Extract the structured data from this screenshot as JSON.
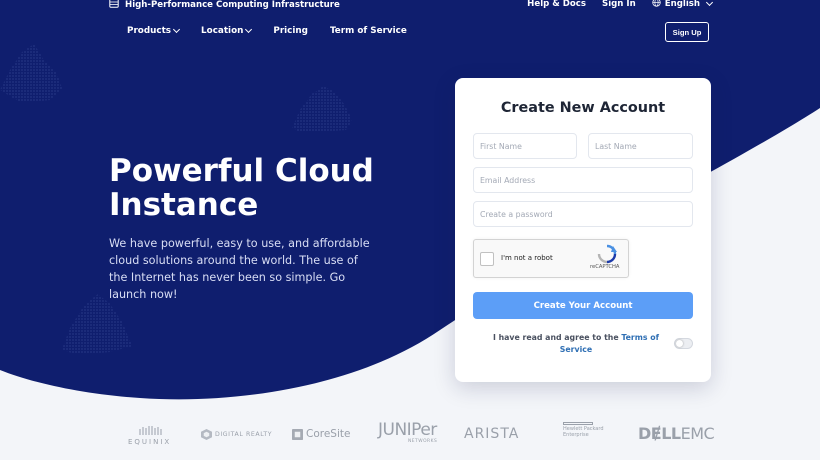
{
  "topbar": {
    "brand": "High-Performance Computing Infrastructure",
    "help": "Help & Docs",
    "signin": "Sign In",
    "language": "English"
  },
  "nav": {
    "items": [
      {
        "label": "Products",
        "dropdown": true
      },
      {
        "label": "Location",
        "dropdown": true
      },
      {
        "label": "Pricing",
        "dropdown": false
      },
      {
        "label": "Term of Service",
        "dropdown": false
      }
    ],
    "signup": "Sign Up"
  },
  "hero": {
    "title": "Powerful Cloud Instance",
    "description": "We have powerful, easy to use, and affordable cloud solutions around the world. The use of the Internet has never been so simple. Go launch now!"
  },
  "form": {
    "title": "Create New Account",
    "first_name_placeholder": "First Name",
    "last_name_placeholder": "Last Name",
    "email_placeholder": "Email Address",
    "password_placeholder": "Create a password",
    "captcha_label": "I'm not a robot",
    "captcha_brand": "reCAPTCHA",
    "submit": "Create Your Account",
    "agree_prefix": "I have read and agree to the ",
    "agree_link": "Terms of Service"
  },
  "partners": {
    "equinix": "EQUINIX",
    "digital_realty": "DIGITAL REALTY",
    "coresite": "CoreSite",
    "juniper": "JUNIPer",
    "juniper_sub": "NETWORKS",
    "arista": "ARISTA",
    "hpe_line1": "Hewlett Packard",
    "hpe_line2": "Enterprise",
    "dell": "DɆLL",
    "emc": "EMC"
  },
  "colors": {
    "hero_navy": "#0f1e6e",
    "accent_blue": "#5c9ef7",
    "link_blue": "#2f6fb4"
  }
}
